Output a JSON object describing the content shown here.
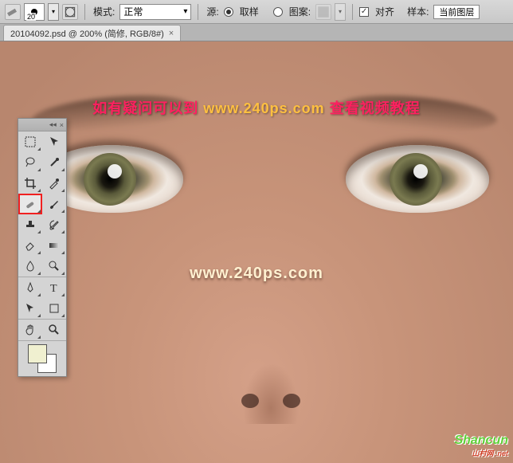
{
  "options_bar": {
    "brush_size": "20",
    "mode_label": "模式:",
    "mode_value": "正常",
    "source_label": "源:",
    "source_sample": "取样",
    "source_pattern": "图案:",
    "align_label": "对齐",
    "sample_label": "样本:",
    "sample_value": "当前图层"
  },
  "tab": {
    "title": "20104092.psd @ 200% (简修, RGB/8#)",
    "close": "×"
  },
  "overlay": {
    "line1_a": "如有疑问可以到",
    "line1_link": "www.240ps.com",
    "line1_b": "查看视频教程",
    "line2": "www.240ps.com"
  },
  "tools_panel": {
    "collapse": "◂◂",
    "close": "×"
  },
  "swatches": {
    "fg": "#f0f0d0",
    "bg": "#ffffff"
  },
  "watermark": {
    "main": "Shancun",
    "sub": "山村网 .net"
  }
}
